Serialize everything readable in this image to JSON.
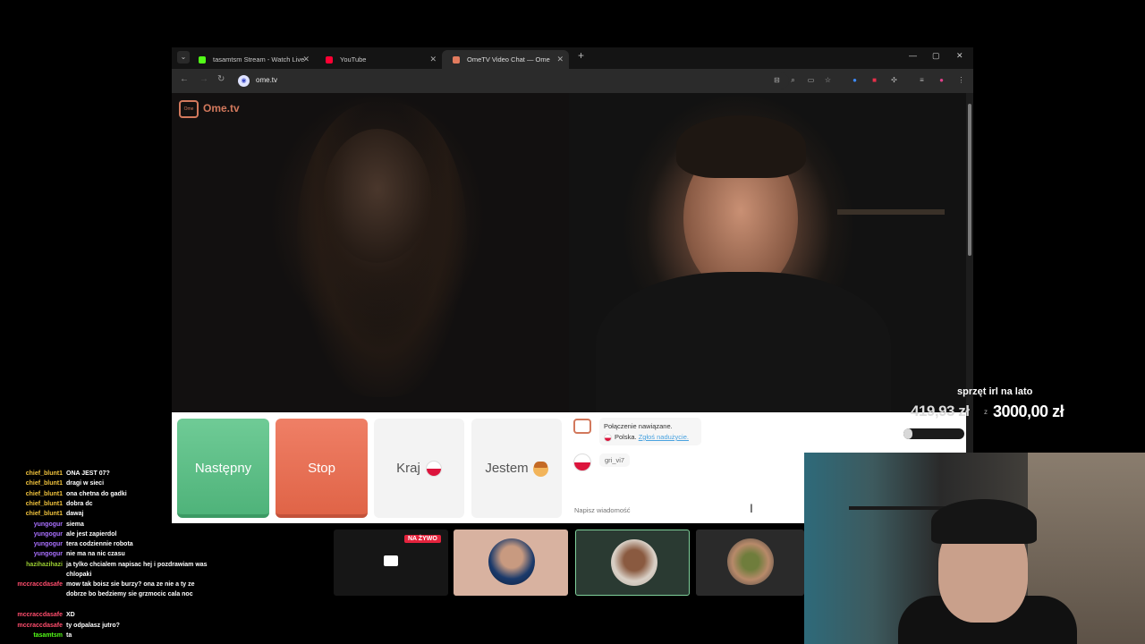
{
  "browser": {
    "tabs": [
      {
        "label": "tasamtsm Stream - Watch Live",
        "favicon_color": "#53fc18",
        "active": false
      },
      {
        "label": "YouTube",
        "favicon_color": "#ff0033",
        "active": false
      },
      {
        "label": "OmeTV Video Chat — Ome",
        "favicon_color": "#e27b5e",
        "active": true
      }
    ],
    "url": "ome.tv"
  },
  "page": {
    "logo_text": "Ome.tv",
    "buttons": {
      "next": "Następny",
      "stop": "Stop",
      "country": "Kraj",
      "iam": "Jestem"
    },
    "chat": {
      "system_line1": "Połączenie nawiązane.",
      "country": "Polska.",
      "report_link": "Zgłoś nadużycie.",
      "partner_message": "gri_vi7",
      "input_placeholder": "Napisz wiadomość"
    }
  },
  "goal": {
    "title": "sprzęt irl na lato",
    "current": "419,93 zł",
    "separator": "z",
    "target": "3000,00 zł",
    "progress": 0.14
  },
  "stream_chat": [
    {
      "user": "chief_blunt1",
      "color": "#f0c23c",
      "text": "ONA JEST 07?"
    },
    {
      "user": "chief_blunt1",
      "color": "#f0c23c",
      "text": "dragi w sieci"
    },
    {
      "user": "chief_blunt1",
      "color": "#f0c23c",
      "text": "ona chetna do gadki"
    },
    {
      "user": "chief_blunt1",
      "color": "#f0c23c",
      "text": "dobra dc"
    },
    {
      "user": "chief_blunt1",
      "color": "#f0c23c",
      "text": "dawaj"
    },
    {
      "user": "yungogur",
      "color": "#a970ff",
      "text": "siema"
    },
    {
      "user": "yungogur",
      "color": "#a970ff",
      "text": "ale jest zapierdol"
    },
    {
      "user": "yungogur",
      "color": "#a970ff",
      "text": "tera codziennie robota"
    },
    {
      "user": "yungogur",
      "color": "#a970ff",
      "text": "nie ma na nic czasu"
    },
    {
      "user": "hazihazihazi",
      "color": "#9acd32",
      "text": "ja tylko chcialem napisac hej i pozdrawiam was chlopaki"
    },
    {
      "user": "mccraccdasafe",
      "color": "#ff4d6d",
      "text": "mow tak boisz sie burzy? ona ze nie a ty ze dobrze bo bedziemy sie grzmocic cala noc"
    },
    {
      "user": "mccraccdasafe",
      "color": "#ff4d6d",
      "text": "XD"
    },
    {
      "user": "mccraccdasafe",
      "color": "#ff4d6d",
      "text": "ty odpalasz jutro?"
    },
    {
      "user": "tasamtsm",
      "color": "#53fc18",
      "text": "ta"
    }
  ],
  "thumbnails": {
    "live_badge": "NA ŻYWO"
  }
}
